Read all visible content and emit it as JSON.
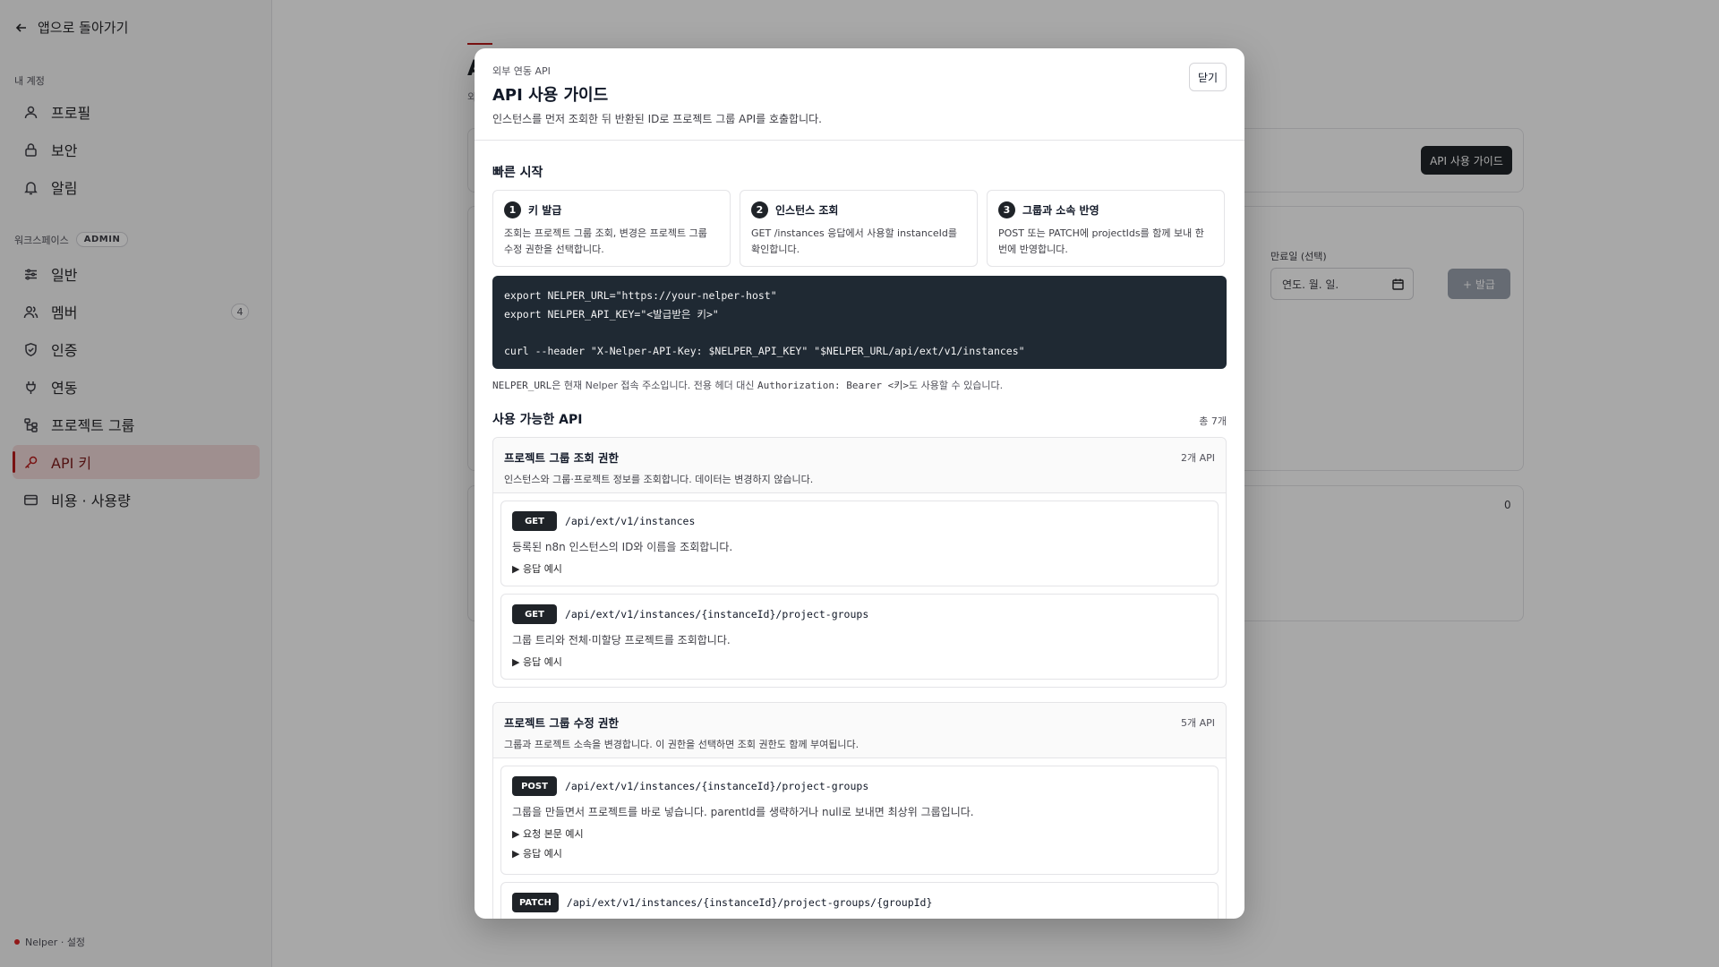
{
  "sidebar": {
    "back_label": "앱으로 돌아가기",
    "account_section": "내 계정",
    "account_items": [
      {
        "label": "프로필",
        "icon": "user-icon"
      },
      {
        "label": "보안",
        "icon": "lock-icon"
      },
      {
        "label": "알림",
        "icon": "bell-icon"
      }
    ],
    "workspace_section": "워크스페이스",
    "workspace_badge": "ADMIN",
    "workspace_items": [
      {
        "label": "일반",
        "icon": "sliders-icon"
      },
      {
        "label": "멤버",
        "icon": "users-icon",
        "count": "4"
      },
      {
        "label": "인증",
        "icon": "shield-icon"
      },
      {
        "label": "연동",
        "icon": "plug-icon"
      },
      {
        "label": "프로젝트 그룹",
        "icon": "hierarchy-icon"
      },
      {
        "label": "API 키",
        "icon": "key-icon",
        "active": true
      },
      {
        "label": "비용 · 사용량",
        "icon": "card-icon"
      }
    ],
    "footer": "Nelper · 설정"
  },
  "background": {
    "title": "A",
    "subtitle": "외",
    "guide_button": "API 사용 가이드",
    "date_label": "만료일 (선택)",
    "date_placeholder": "연도. 월. 일.",
    "issue_button": "+ 발급",
    "key_count": "0"
  },
  "modal": {
    "eyebrow": "외부 연동 API",
    "title": "API 사용 가이드",
    "description": "인스턴스를 먼저 조회한 뒤 반환된 ID로 프로젝트 그룹 API를 호출합니다.",
    "close_label": "닫기",
    "quick_start_title": "빠른 시작",
    "steps": [
      {
        "num": "1",
        "title": "키 발급",
        "desc": "조회는 프로젝트 그룹 조회, 변경은 프로젝트 그룹 수정 권한을 선택합니다."
      },
      {
        "num": "2",
        "title": "인스턴스 조회",
        "desc": "GET /instances 응답에서 사용할 instanceId를 확인합니다."
      },
      {
        "num": "3",
        "title": "그룹과 소속 반영",
        "desc": "POST 또는 PATCH에 projectIds를 함께 보내 한 번에 반영합니다."
      }
    ],
    "code_lines": [
      "export NELPER_URL=\"https://your-nelper-host\"",
      "export NELPER_API_KEY=\"<발급받은 키>\"",
      "",
      "curl --header \"X-Nelper-API-Key: $NELPER_API_KEY\" \"$NELPER_URL/api/ext/v1/instances\""
    ],
    "code_note_1": "NELPER_URL",
    "code_note_2": "은 현재 Nelper 접속 주소입니다. 전용 헤더 대신 ",
    "code_note_3": "Authorization: Bearer <키>",
    "code_note_4": "도 사용할 수 있습니다.",
    "available_title": "사용 가능한 API",
    "available_total": "총 7개",
    "groups": [
      {
        "title": "프로젝트 그룹 조회 권한",
        "desc": "인스턴스와 그룹·프로젝트 정보를 조회합니다. 데이터는 변경하지 않습니다.",
        "count": "2개 API",
        "apis": [
          {
            "method": "GET",
            "path": "/api/ext/v1/instances",
            "desc": "등록된 n8n 인스턴스의 ID와 이름을 조회합니다.",
            "details": [
              "▶ 응답 예시"
            ]
          },
          {
            "method": "GET",
            "path": "/api/ext/v1/instances/{instanceId}/project-groups",
            "desc": "그룹 트리와 전체·미할당 프로젝트를 조회합니다.",
            "details": [
              "▶ 응답 예시"
            ]
          }
        ]
      },
      {
        "title": "프로젝트 그룹 수정 권한",
        "desc": "그룹과 프로젝트 소속을 변경합니다. 이 권한을 선택하면 조회 권한도 함께 부여됩니다.",
        "count": "5개 API",
        "apis": [
          {
            "method": "POST",
            "path": "/api/ext/v1/instances/{instanceId}/project-groups",
            "desc": "그룹을 만들면서 프로젝트를 바로 넣습니다. parentId를 생략하거나 null로 보내면 최상위 그룹입니다.",
            "details": [
              "▶ 요청 본문 예시",
              "▶ 응답 예시"
            ]
          },
          {
            "method": "PATCH",
            "path": "/api/ext/v1/instances/{instanceId}/project-groups/{groupId}",
            "desc": "",
            "details": []
          }
        ]
      }
    ]
  }
}
